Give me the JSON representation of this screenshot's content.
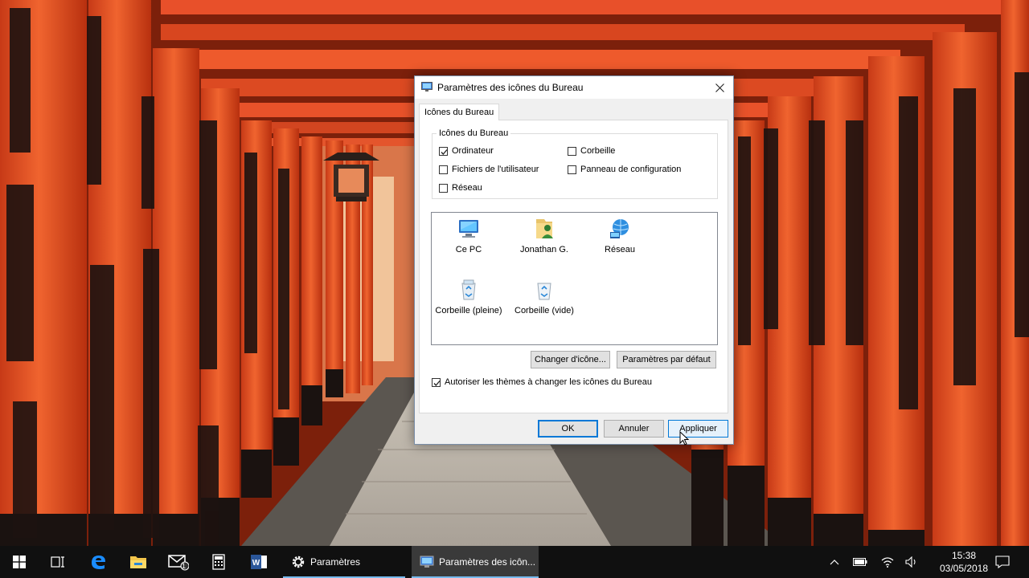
{
  "dialog": {
    "title": "Paramètres des icônes du Bureau",
    "tab": "Icônes du Bureau",
    "group_legend": "Icônes du Bureau",
    "checkboxes": [
      {
        "label": "Ordinateur",
        "checked": true
      },
      {
        "label": "Corbeille",
        "checked": false
      },
      {
        "label": "Fichiers de l'utilisateur",
        "checked": false
      },
      {
        "label": "Panneau de configuration",
        "checked": false
      },
      {
        "label": "Réseau",
        "checked": false
      }
    ],
    "icons": [
      {
        "label": "Ce PC",
        "icon": "computer-icon"
      },
      {
        "label": "Jonathan G.",
        "icon": "user-folder-icon"
      },
      {
        "label": "Réseau",
        "icon": "network-icon"
      },
      {
        "label": "Corbeille (pleine)",
        "icon": "recycle-bin-full-icon"
      },
      {
        "label": "Corbeille (vide)",
        "icon": "recycle-bin-empty-icon"
      }
    ],
    "change_icon_button": "Changer d'icône...",
    "default_button": "Paramètres par défaut",
    "allow_themes": {
      "label": "Autoriser les thèmes à changer les icônes du Bureau",
      "checked": true
    },
    "ok": "OK",
    "cancel": "Annuler",
    "apply": "Appliquer"
  },
  "taskbar": {
    "apps": [
      {
        "label": "Paramètres",
        "icon": "gear-icon"
      },
      {
        "label": "Paramètres des icôn...",
        "icon": "desktop-icon-settings-icon"
      }
    ],
    "mail_badge": "1",
    "time": "15:38",
    "date": "03/05/2018"
  },
  "colors": {
    "accent": "#0078d7",
    "taskbar": "#101010",
    "wallpaper_red": "#e8502a"
  }
}
